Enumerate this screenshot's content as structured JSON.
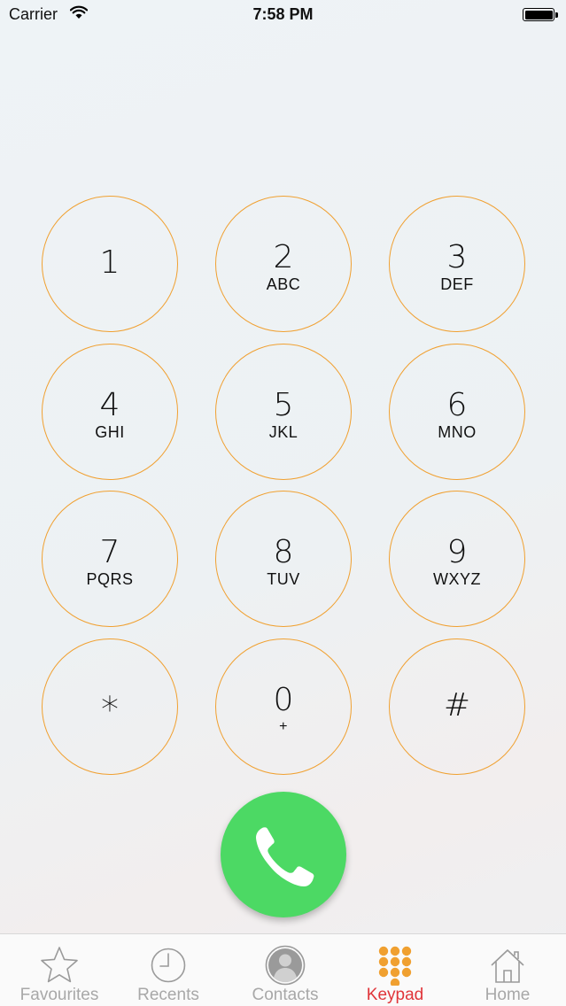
{
  "status_bar": {
    "carrier": "Carrier",
    "time": "7:58 PM",
    "wifi_icon": "wifi-icon",
    "battery_icon": "battery-icon"
  },
  "keypad": {
    "accent_color": "#f0a030",
    "keys": [
      {
        "digit": "1",
        "letters": ""
      },
      {
        "digit": "2",
        "letters": "ABC"
      },
      {
        "digit": "3",
        "letters": "DEF"
      },
      {
        "digit": "4",
        "letters": "GHI"
      },
      {
        "digit": "5",
        "letters": "JKL"
      },
      {
        "digit": "6",
        "letters": "MNO"
      },
      {
        "digit": "7",
        "letters": "PQRS"
      },
      {
        "digit": "8",
        "letters": "TUV"
      },
      {
        "digit": "9",
        "letters": "WXYZ"
      },
      {
        "digit": "*",
        "letters": ""
      },
      {
        "digit": "0",
        "letters": "+"
      },
      {
        "digit": "#",
        "letters": ""
      }
    ]
  },
  "call_button": {
    "icon": "phone-icon",
    "color": "#4cd964"
  },
  "tab_bar": {
    "active_color": "#e0353a",
    "inactive_color": "#a8a8a8",
    "accent_icon_color": "#f0a030",
    "tabs": [
      {
        "label": "Favourites",
        "icon": "star-icon",
        "active": false
      },
      {
        "label": "Recents",
        "icon": "clock-icon",
        "active": false
      },
      {
        "label": "Contacts",
        "icon": "contact-icon",
        "active": false
      },
      {
        "label": "Keypad",
        "icon": "keypad-icon",
        "active": true
      },
      {
        "label": "Home",
        "icon": "home-icon",
        "active": false
      }
    ]
  }
}
